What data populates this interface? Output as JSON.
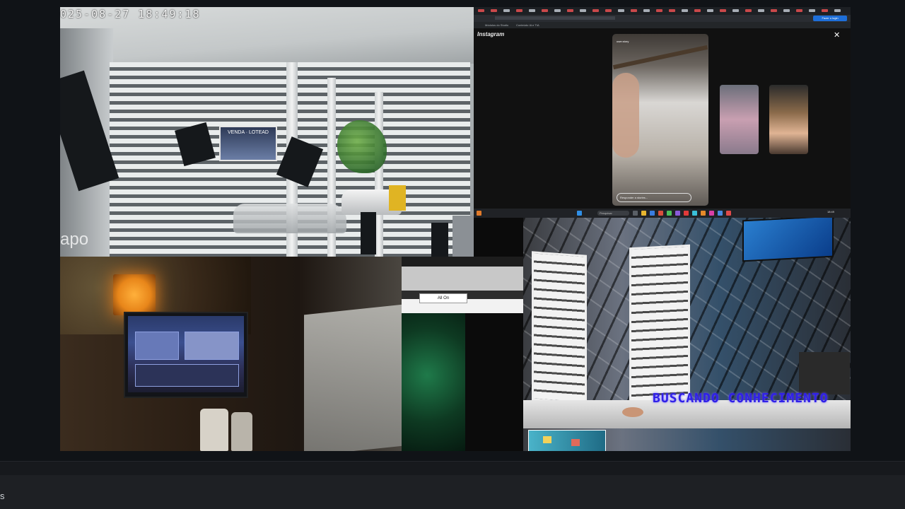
{
  "stream": {
    "camera1": {
      "timestamp": "025-08-27  18:49:18",
      "brand_watermark": "apo",
      "sign_text": "VENDA · LOTEAD"
    },
    "camera2": {
      "site_logo": "Instagram",
      "close_glyph": "✕",
      "address_button": "Fazer o login",
      "bookmarks": [
        "Módulos do Studio",
        "Conteúdo IA e TIA"
      ],
      "story_user": "user.story",
      "reply_placeholder": "Responder a stories...",
      "taskbar_search": "Pesquisar",
      "taskbar_time": "18:49"
    },
    "popup": {
      "button_label": "All On"
    },
    "camera5": {
      "overlay_text": "BUSCANDO CONHECIMENTO"
    }
  },
  "footer": {
    "label": "s"
  },
  "colors": {
    "background": "#101317",
    "overlay_text": "#3020e8",
    "lamp": "#ffb03b"
  }
}
